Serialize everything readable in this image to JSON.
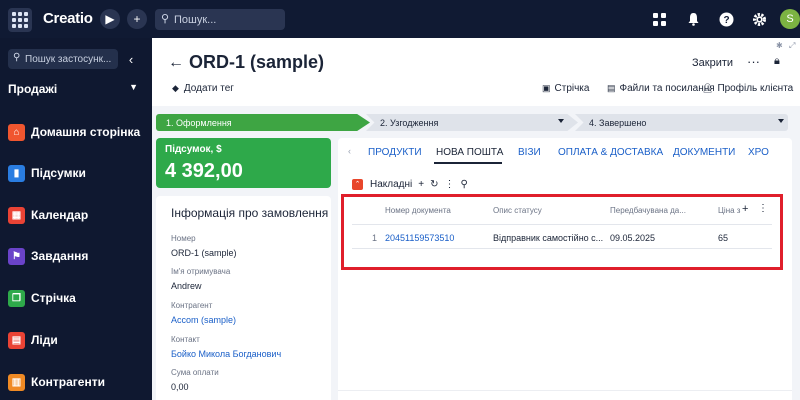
{
  "topbar": {
    "logo": "Creatio",
    "search_placeholder": "Пошук..."
  },
  "sidebar": {
    "search_placeholder": "Пошук застосунк...",
    "section": "Продажі",
    "items": [
      {
        "label": "Домашня сторінка",
        "icon": "home-icon",
        "color": "#f0562f"
      },
      {
        "label": "Підсумки",
        "icon": "bar-chart-icon",
        "color": "#2a7de1"
      },
      {
        "label": "Календар",
        "icon": "calendar-icon",
        "color": "#ea4335"
      },
      {
        "label": "Завдання",
        "icon": "flag-icon",
        "color": "#6a43c9"
      },
      {
        "label": "Стрічка",
        "icon": "feed-icon",
        "color": "#2ea94a"
      },
      {
        "label": "Ліди",
        "icon": "leads-icon",
        "color": "#ea4335"
      },
      {
        "label": "Контрагенти",
        "icon": "building-icon",
        "color": "#f08a24"
      }
    ]
  },
  "header": {
    "title": "ORD-1 (sample)",
    "add_tag": "Додати тег",
    "close": "Закрити",
    "feed": "Стрічка",
    "files": "Файли та посилання",
    "client_profile": "Профіль клієнта"
  },
  "stages": [
    {
      "label": "1. Оформлення",
      "active": true
    },
    {
      "label": "2. Узгодження",
      "active": false
    },
    {
      "label": "4. Завершено",
      "active": false
    }
  ],
  "summary": {
    "label": "Підсумок, $",
    "value": "4 392,00"
  },
  "info": {
    "heading": "Інформація про замовлення",
    "fields": [
      {
        "label": "Номер",
        "value": "ORD-1 (sample)"
      },
      {
        "label": "Ім'я отримувача",
        "value": "Andrew"
      },
      {
        "label": "Контрагент",
        "value": "Accom (sample)"
      },
      {
        "label": "Контакт",
        "value": "Бойко Микола Богданович"
      },
      {
        "label": "Сума оплати",
        "value": "0,00"
      }
    ]
  },
  "tabs": [
    "ПРОДУКТИ",
    "НОВА ПОШТА",
    "ВІЗИ",
    "ОПЛАТА & ДОСТАВКА",
    "ДОКУМЕНТИ",
    "ХРО"
  ],
  "active_tab": "НОВА ПОШТА",
  "detail": {
    "title": "Накладні",
    "columns": [
      "Номер документа",
      "Опис статусу",
      "Передбачувана да...",
      "Ціна з"
    ],
    "rows": [
      {
        "index": "1",
        "doc_number": "20451159573510",
        "status": "Відправник самостійно с...",
        "date": "09.05.2025",
        "price": "65"
      }
    ]
  }
}
